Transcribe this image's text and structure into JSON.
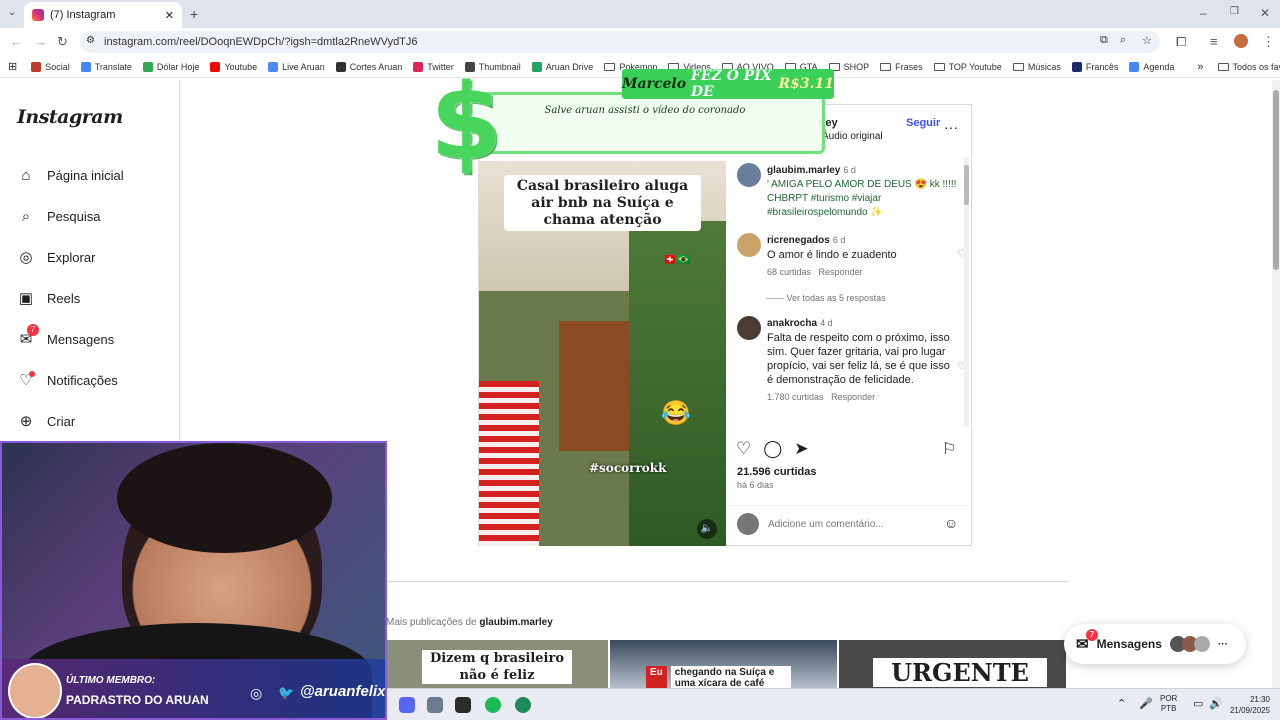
{
  "tab": {
    "title": "(7) Instagram"
  },
  "address": {
    "url": "instagram.com/reel/DOoqnEWDpCh/?igsh=dmtla2RneWVydTJ6"
  },
  "bookmarks": [
    "Social",
    "Translate",
    "Dólar Hoje",
    "Youtube",
    "Live Aruan",
    "Cortes Aruan",
    "Twitter",
    "Thumbnail",
    "Aruan Drive",
    "Pokemon",
    "Videos",
    "AO VIVO",
    "GTA",
    "SHOP",
    "Frases",
    "TOP Youtube",
    "Músicas",
    "Francês",
    "Agenda"
  ],
  "bookmarks_all": "Todos os favoritos",
  "instagram": {
    "logo": "Instagram",
    "nav": [
      {
        "label": "Página inicial",
        "icon": "home-icon"
      },
      {
        "label": "Pesquisa",
        "icon": "search-icon"
      },
      {
        "label": "Explorar",
        "icon": "compass-icon"
      },
      {
        "label": "Reels",
        "icon": "reels-icon"
      },
      {
        "label": "Mensagens",
        "icon": "messenger-icon",
        "badge": "7"
      },
      {
        "label": "Notificações",
        "icon": "heart-icon"
      },
      {
        "label": "Criar",
        "icon": "plus-icon"
      }
    ]
  },
  "post": {
    "author_partial": "rley",
    "audio": "Áudio original",
    "follow": "Seguir",
    "video_caption": "Casal brasileiro aluga air bnb na Suíça e chama atenção",
    "video_tag": "#socorrokk",
    "comments": [
      {
        "user": "glaubim.marley",
        "age": "6 d",
        "text": "' AMIGA PELO AMOR DE DEUS 😍 kk !!!!! CHBRPT #turismo #viajar #brasileirospelomundo ✨"
      },
      {
        "user": "ricrenegados",
        "age": "6 d",
        "text": "O amor é lindo e zuadento",
        "likes": "68 curtidas",
        "reply": "Responder"
      },
      {
        "user": "anakrocha",
        "age": "4 d",
        "text": "Falta de respeito com o próximo, isso sim. Quer fazer gritaria, vai pro lugar propício, vai ser feliz lá, se é que isso é demonstração de felicidade.",
        "likes": "1.780 curtidas",
        "reply": "Responder"
      }
    ],
    "view_replies": "Ver todas as 5 respostas",
    "likes": "21.596 curtidas",
    "posted": "há 6 dias",
    "comment_placeholder": "Adicione um comentário..."
  },
  "overlay": {
    "pix_name": "Marcelo",
    "pix_text": "FEZ O PIX DE",
    "pix_value": "R$3.11",
    "pix_message": "Salve aruan assisti o vídeo do coronado"
  },
  "more_posts": {
    "prefix": "Mais publicações de",
    "user": "glaubim.marley",
    "thumb1": "Dizem q brasileiro não é feliz",
    "thumb2_badge": "Eu",
    "thumb2": "chegando na Suíça e uma xícara de café",
    "thumb3": "URGENTE"
  },
  "messages_btn": {
    "label": "Mensagens",
    "badge": "7"
  },
  "cam": {
    "member_label": "ÚLTIMO MEMBRO:",
    "member_name": "PADRASTRO DO ARUAN",
    "handle": "@aruanfelix"
  },
  "taskbar": {
    "lang1": "POR",
    "lang2": "PTB",
    "time": "21:30",
    "date": "21/09/2025"
  }
}
